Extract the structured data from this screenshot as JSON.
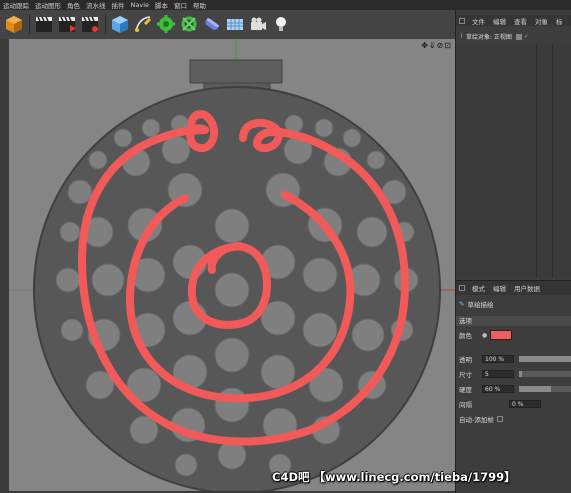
{
  "menu": [
    "运动跟踪",
    "运动图形",
    "角色",
    "流水线",
    "插件",
    "Navie",
    "脚本",
    "窗口",
    "帮助"
  ],
  "toolbar_icons": [
    "cube-icon",
    "film-clapper-icon",
    "film-clapper-play-icon",
    "film-clapper-settings-icon",
    "primitive-cube-icon",
    "pen-spline-icon",
    "gear-green-icon",
    "gear-deformer-icon",
    "capsule-icon",
    "floor-plane-icon",
    "camera-icon",
    "light-bulb-icon"
  ],
  "viewport": {
    "controls": "✥⇓⊘⊡"
  },
  "object_manager": {
    "tabs": [
      "文件",
      "编辑",
      "查看",
      "对象",
      "标"
    ],
    "object_name": "草绘对象: 正视图"
  },
  "attribute_manager": {
    "tabs": [
      "模式",
      "编辑",
      "用户数据"
    ],
    "title": "草绘描绘",
    "section": "选项",
    "color_label": "颜色",
    "color_value": "#f15d5d",
    "properties": [
      {
        "label": "透明",
        "value": "100 %",
        "fill": 1.0
      },
      {
        "label": "尺寸",
        "value": "5",
        "fill": 0.05
      },
      {
        "label": "硬度",
        "value": "60 %",
        "fill": 0.6
      },
      {
        "label": "间隔",
        "value": "0 %",
        "fill": 0.0
      }
    ],
    "auto_add_label": "自动-添加帧"
  },
  "watermark": "C4D吧 【www.linecg.com/tieba/1799】"
}
